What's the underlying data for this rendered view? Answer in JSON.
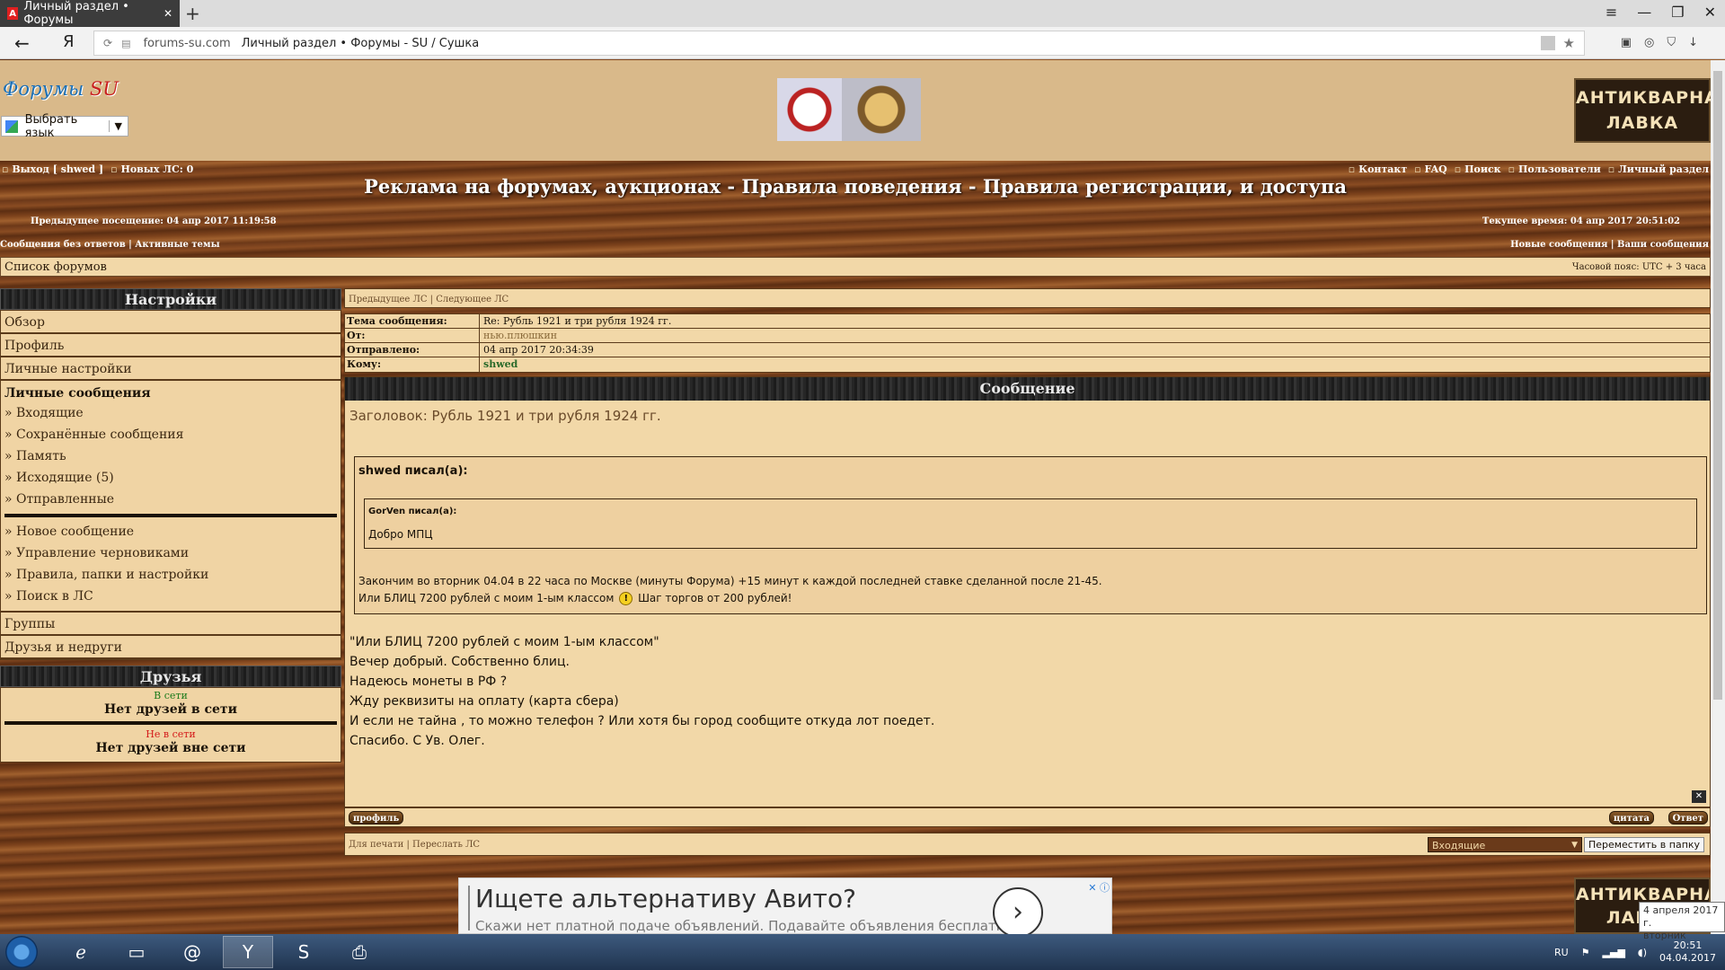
{
  "browser": {
    "tab_title": "Личный раздел • Форумы",
    "tab_close": "✕",
    "new_tab": "+",
    "back": "←",
    "yandex_logo": "Я",
    "url_domain": "forums-su.com",
    "url_title": "Личный раздел • Форумы - SU / Сушка",
    "window_controls": [
      "≡",
      "—",
      "❐",
      "✕"
    ],
    "download_icon": "↓"
  },
  "header": {
    "logo_main": "Форумы ",
    "logo_accent": "SU",
    "lang_select": "Выбрать язык",
    "ad_top": "АНТИКВАРНАЯ ЛАВКА"
  },
  "topnav": {
    "logout": "Выход [ shwed ]",
    "new_pm": "Новых ЛС: 0",
    "right_links": [
      "Контакт",
      "FAQ",
      "Поиск",
      "Пользователи",
      "Личный раздел"
    ]
  },
  "banner": "Реклама на форумах, аукционах - Правила поведения - Правила регистрации, и доступа",
  "info": {
    "last_visit": "Предыдущее посещение: 04 апр 2017 11:19:58",
    "current_time": "Текущее время: 04 апр 2017 20:51:02",
    "left_links": "Сообщения без ответов | Активные темы",
    "right_links": "Новые сообщения | Ваши сообщения"
  },
  "crumb": {
    "forum_list": "Список форумов",
    "timezone": "Часовой пояс: UTC + 3 часа"
  },
  "sidebar": {
    "settings_title": "Настройки",
    "top_items": [
      "Обзор",
      "Профиль",
      "Личные настройки"
    ],
    "pm_title": "Личные сообщения",
    "pm_folders": [
      "» Входящие",
      "» Сохранённые сообщения",
      "» Память",
      "» Исходящие (5)",
      "» Отправленные"
    ],
    "pm_actions": [
      "» Новое сообщение",
      "» Управление черновиками",
      "» Правила, папки и настройки",
      "» Поиск в ЛС"
    ],
    "bottom_items": [
      "Группы",
      "Друзья и недруги"
    ],
    "friends_title": "Друзья",
    "online_label": "В сети",
    "no_online": "Нет друзей в сети",
    "offline_label": "Не в сети",
    "no_offline": "Нет друзей вне сети"
  },
  "message": {
    "nav": "Предыдущее ЛС | Следующее ЛС",
    "subject_label": "Тема сообщения:",
    "subject": "Re: Рубль 1921 и три рубля 1924 гг.",
    "from_label": "От:",
    "from": "нью.плюшкин",
    "sent_label": "Отправлено:",
    "sent": "04 апр 2017 20:34:39",
    "to_label": "Кому:",
    "to": "shwed",
    "header": "Сообщение",
    "title": "Заголовок: Рубль 1921 и три рубля 1924 гг.",
    "quote_author": "shwed писал(а):",
    "inner_quote_author": "GorVen писал(а):",
    "inner_quote_text": "Добро МПЦ",
    "quote_line1": "Закончим во вторник 04.04 в 22 часа по Москве (минуты Форума) +15 минут к каждой последней ставке сделанной после 21-45.",
    "quote_line2_a": "Или БЛИЦ 7200 рублей с моим 1-ым классом",
    "quote_line2_b": "Шаг торгов от 200 рублей!",
    "body": [
      "\"Или БЛИЦ 7200 рублей с моим 1-ым классом\"",
      "Вечер добрый. Собственно блиц.",
      "Надеюсь монеты в РФ ?",
      "Жду реквизиты на оплату (карта сбера)",
      "И если не тайна , то можно телефон ? Или хотя бы город сообщите откуда лот поедет.",
      "Спасибо. С Ув. Олег."
    ],
    "btn_profile": "профиль",
    "btn_quote": "цитата",
    "btn_reply": "Ответ",
    "bottom_links": "Для печати | Переслать ЛС",
    "folder_value": "Входящие",
    "move_button": "Переместить в папку"
  },
  "ads": {
    "avito_title": "Ищете альтернативу Авито?",
    "avito_sub": "Скажи нет платной подаче объявлений. Подавайте объявления бесплатно!",
    "ad_bottom": "АНТИКВАРНАЯ ЛАВКА"
  },
  "taskbar": {
    "lang": "RU",
    "time": "20:51",
    "date": "04.04.2017",
    "tooltip_line1": "4 апреля 2017 г.",
    "tooltip_line2": "вторник"
  }
}
